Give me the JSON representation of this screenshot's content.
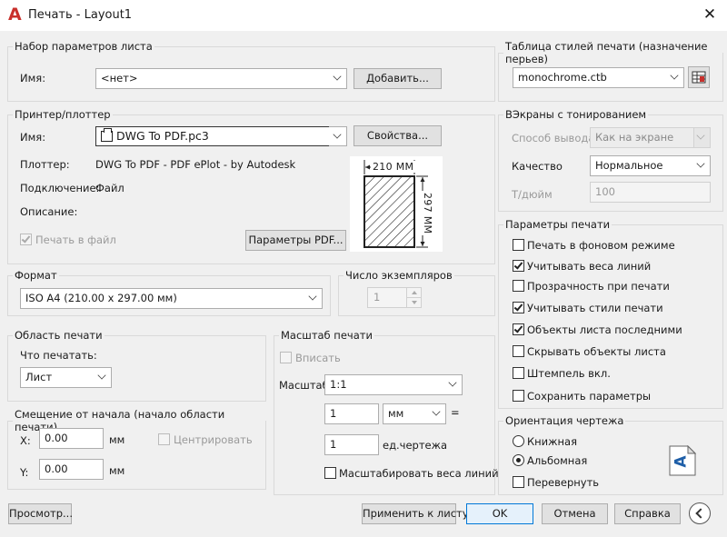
{
  "window": {
    "title": "Печать - Layout1"
  },
  "page_setup": {
    "group_label": "Набор параметров листа",
    "name_label": "Имя:",
    "name_value": "<нет>",
    "add_button": "Добавить..."
  },
  "printer": {
    "group_label": "Принтер/плоттер",
    "name_label": "Имя:",
    "name_value": "DWG To PDF.pc3",
    "properties_button": "Свойства...",
    "plotter_label": "Плоттер:",
    "plotter_value": "DWG To PDF - PDF ePlot - by Autodesk",
    "where_label": "Подключение:",
    "where_value": "Файл",
    "description_label": "Описание:",
    "plot_to_file_label": "Печать в файл",
    "plot_to_file_checked": true,
    "pdf_options_button": "Параметры PDF...",
    "paper_width_label": "210 MM",
    "paper_height_label": "297 MM"
  },
  "paper_size": {
    "group_label": "Формат",
    "value": "ISO A4 (210.00 x 297.00 мм)"
  },
  "copies": {
    "group_label": "Число экземпляров",
    "value": "1"
  },
  "plot_area": {
    "group_label": "Область печати",
    "what_label": "Что печатать:",
    "what_value": "Лист"
  },
  "plot_offset": {
    "group_label": "Смещение от начала (начало области печати)",
    "x_label": "X:",
    "x_value": "0.00",
    "x_unit": "мм",
    "y_label": "Y:",
    "y_value": "0.00",
    "y_unit": "мм",
    "center_label": "Центрировать"
  },
  "plot_scale": {
    "group_label": "Масштаб печати",
    "fit_label": "Вписать",
    "scale_label": "Масштаб:",
    "scale_value": "1:1",
    "value1": "1",
    "unit1": "мм",
    "equals": "=",
    "value2": "1",
    "unit2": "ед.чертежа",
    "lineweights_label": "Масштабировать веса линий"
  },
  "style_table": {
    "group_label": "Таблица стилей печати (назначение перьев)",
    "value": "monochrome.ctb"
  },
  "shaded_viewport": {
    "group_label": "ВЭкраны с тонированием",
    "shade_label": "Способ вывода",
    "shade_value": "Как на экране",
    "quality_label": "Качество",
    "quality_value": "Нормальное",
    "dpi_label": "Т/дюйм",
    "dpi_value": "100"
  },
  "plot_options": {
    "group_label": "Параметры печати",
    "items": [
      {
        "label": "Печать в фоновом режиме",
        "checked": false
      },
      {
        "label": "Учитывать веса линий",
        "checked": true
      },
      {
        "label": "Прозрачность при печати",
        "checked": false
      },
      {
        "label": "Учитывать стили печати",
        "checked": true
      },
      {
        "label": "Объекты листа последними",
        "checked": true
      },
      {
        "label": "Скрывать объекты листа",
        "checked": false
      },
      {
        "label": "Штемпель вкл.",
        "checked": false
      },
      {
        "label": "Сохранить параметры",
        "checked": false
      }
    ]
  },
  "orientation": {
    "group_label": "Ориентация чертежа",
    "portrait_label": "Книжная",
    "landscape_label": "Альбомная",
    "selected": "Альбомная",
    "upside_down_label": "Перевернуть",
    "preview_letter": "A"
  },
  "footer": {
    "preview_button": "Просмотр...",
    "apply_button": "Применить к листу",
    "ok_button": "OK",
    "cancel_button": "Отмена",
    "help_button": "Справка"
  },
  "colors": {
    "accent": "#0078d7",
    "app_logo": "#c9302c"
  }
}
